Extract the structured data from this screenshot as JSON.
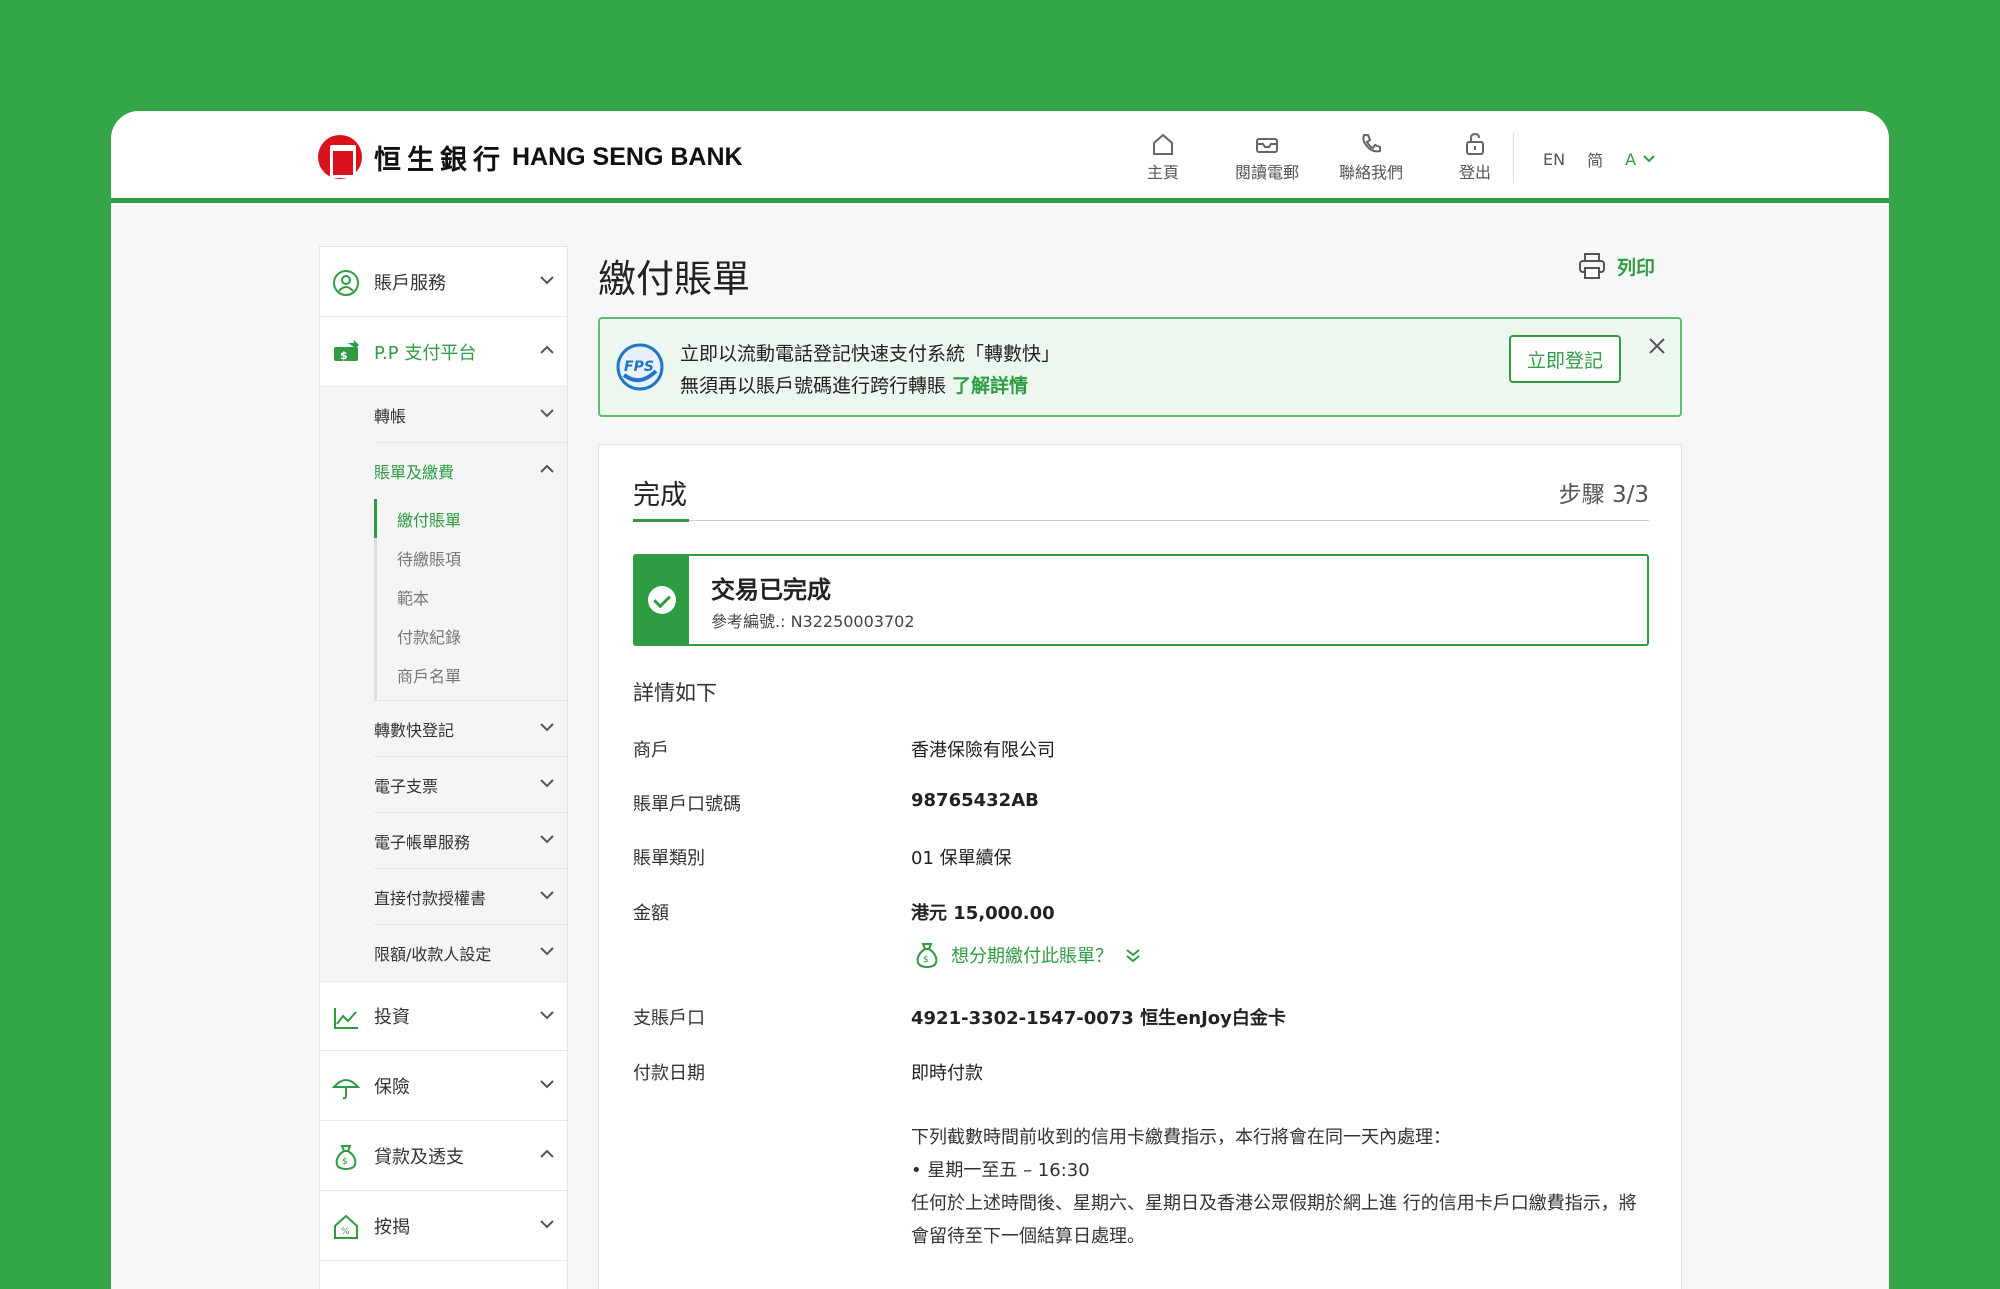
{
  "header": {
    "brand_cn": "恒生銀行",
    "brand_en": "HANG SENG BANK",
    "nav": [
      {
        "label": "主頁",
        "icon": "home-icon"
      },
      {
        "label": "閱讀電郵",
        "icon": "mailbox-icon"
      },
      {
        "label": "聯絡我們",
        "icon": "phone-icon"
      },
      {
        "label": "登出",
        "icon": "unlock-icon"
      }
    ],
    "lang_en": "EN",
    "lang_sc": "简",
    "font_size": "A"
  },
  "sidebar": {
    "account_services": "賬戶服務",
    "pp_platform": "P.P 支付平台",
    "transfer": "轉帳",
    "bills": "賬單及繳費",
    "bill_items": [
      "繳付賬單",
      "待繳賬項",
      "範本",
      "付款紀錄",
      "商戶名單"
    ],
    "fps_register": "轉數快登記",
    "echeque": "電子支票",
    "ebill": "電子帳單服務",
    "direct_debit": "直接付款授權書",
    "limits": "限額/收款人設定",
    "invest": "投資",
    "insurance": "保險",
    "loans": "貸款及透支",
    "mortgage": "按揭"
  },
  "main": {
    "title": "繳付賬單",
    "print": "列印",
    "banner": {
      "line1": "立即以流動電話登記快速支付系統「轉數快」",
      "line2": "無須再以賬戶號碼進行跨行轉賬",
      "link": "了解詳情",
      "button": "立即登記"
    },
    "card": {
      "title": "完成",
      "step": "步驟 3/3",
      "success_title": "交易已完成",
      "reference": "參考編號.: N32250003702",
      "details_head": "詳情如下",
      "rows": [
        {
          "label": "商戶",
          "value": "香港保險有限公司"
        },
        {
          "label": "賬單戶口號碼",
          "value": "98765432AB"
        },
        {
          "label": "賬單類別",
          "value": "01 保單續保"
        },
        {
          "label": "金額",
          "value": "港元 15,000.00"
        },
        {
          "label": "支賬戶口",
          "value": "4921-3302-1547-0073 恒生enJoy白金卡"
        },
        {
          "label": "付款日期",
          "value": "即時付款"
        }
      ],
      "installment": "想分期繳付此賬單？",
      "note_line1": "下列截數時間前收到的信用卡繳費指示，本行將會在同一天內處理：",
      "note_bullet": "星期一至五 – 16:30",
      "note_line2": "任何於上述時間後、星期六、星期日及香港公眾假期於網上進 行的信用卡戶口繳費指示，將會留待至下一個結算日處理。"
    }
  },
  "colors": {
    "brand_green": "#2f9c43",
    "background_green": "#35a647",
    "logo_red": "#d9121b"
  }
}
